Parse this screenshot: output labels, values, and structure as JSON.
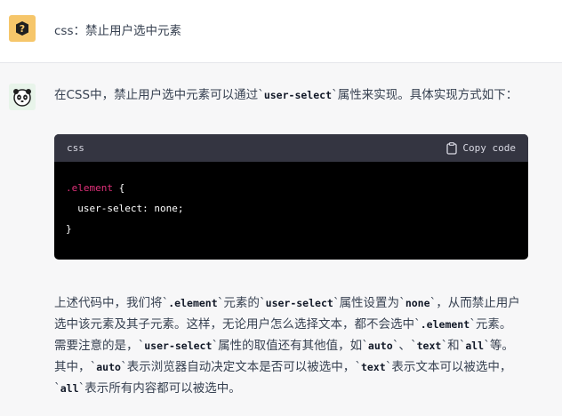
{
  "user": {
    "avatar_icon": "question-badge-icon",
    "message": "css：禁止用户选中元素"
  },
  "assistant": {
    "avatar_icon": "panda-bot-icon",
    "intro": {
      "before": "在CSS中，禁止用户选中元素可以通过`",
      "code": "user-select",
      "after": "`属性来实现。具体实现方式如下："
    },
    "code_block": {
      "language": "css",
      "copy_label": "Copy code",
      "copy_icon": "clipboard-icon",
      "line1_selector": ".element",
      "line1_brace": " {",
      "line2": "  user-select: none;",
      "line3": "}"
    },
    "explanation": {
      "l1_a": "上述代码中，我们将`",
      "l1_code1": ".element",
      "l1_b": "`元素的`",
      "l1_code2": "user-select",
      "l1_c": "`属性设置为`",
      "l1_code3": "none",
      "l1_d": "`，从而禁止用户",
      "l2_a": "选中该元素及其子元素。这样，无论用户怎么选择文本，都不会选中`",
      "l2_code1": ".element",
      "l2_b": "`元素。",
      "l3_a": "需要注意的是，`",
      "l3_code1": "user-select",
      "l3_b": "`属性的取值还有其他值，如`",
      "l3_code2": "auto",
      "l3_c": "`、`",
      "l3_code3": "text",
      "l3_d": "`和`",
      "l3_code4": "all",
      "l3_e": "`等。",
      "l4_a": "其中，`",
      "l4_code1": "auto",
      "l4_b": "`表示浏览器自动决定文本是否可以被选中，`",
      "l4_code2": "text",
      "l4_c": "`表示文本可以被选中，",
      "l5_a": "`",
      "l5_code1": "all",
      "l5_b": "`表示所有内容都可以被选中。"
    }
  }
}
